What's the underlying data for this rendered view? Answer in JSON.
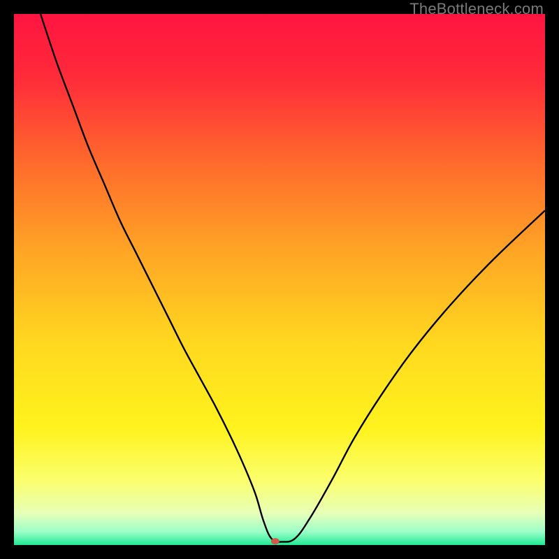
{
  "watermark": "TheBottleneck.com",
  "chart_data": {
    "type": "line",
    "title": "",
    "xlabel": "",
    "ylabel": "",
    "xlim": [
      0,
      100
    ],
    "ylim": [
      0,
      100
    ],
    "background_gradient": {
      "stops": [
        {
          "offset": 0.0,
          "color": "#ff1440"
        },
        {
          "offset": 0.12,
          "color": "#ff2b3a"
        },
        {
          "offset": 0.28,
          "color": "#ff6a2c"
        },
        {
          "offset": 0.45,
          "color": "#ffa625"
        },
        {
          "offset": 0.62,
          "color": "#ffd81f"
        },
        {
          "offset": 0.78,
          "color": "#fff31e"
        },
        {
          "offset": 0.88,
          "color": "#fbff6e"
        },
        {
          "offset": 0.94,
          "color": "#e8ffb8"
        },
        {
          "offset": 0.975,
          "color": "#9cffc8"
        },
        {
          "offset": 1.0,
          "color": "#1fe993"
        }
      ]
    },
    "series": [
      {
        "name": "bottleneck-curve",
        "color": "#000000",
        "width": 2.4,
        "x": [
          5,
          8,
          11,
          14,
          17,
          20,
          23,
          26,
          29,
          32,
          35,
          38,
          41,
          43.5,
          45.5,
          47,
          48.5,
          50.5,
          53,
          56,
          60,
          64,
          69,
          75,
          82,
          90,
          100
        ],
        "y": [
          100,
          91,
          83,
          75,
          68,
          61,
          55,
          49,
          43,
          37,
          31.5,
          26,
          20,
          14.5,
          9.5,
          4.5,
          1.2,
          0.6,
          1.3,
          5.5,
          12.5,
          20,
          28,
          36.5,
          45,
          53.5,
          63
        ]
      }
    ],
    "marker": {
      "name": "minimum-marker",
      "x": 49.2,
      "y": 0.7,
      "rx": 6,
      "ry": 4.5,
      "color": "#d35a4a"
    }
  }
}
